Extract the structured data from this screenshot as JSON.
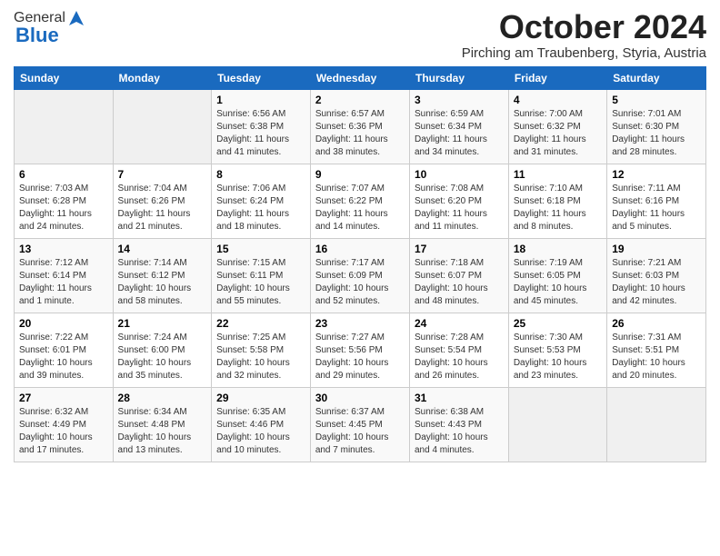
{
  "header": {
    "logo_general": "General",
    "logo_blue": "Blue",
    "month_year": "October 2024",
    "subtitle": "Pirching am Traubenberg, Styria, Austria"
  },
  "days_of_week": [
    "Sunday",
    "Monday",
    "Tuesday",
    "Wednesday",
    "Thursday",
    "Friday",
    "Saturday"
  ],
  "weeks": [
    [
      {
        "day": "",
        "info": ""
      },
      {
        "day": "",
        "info": ""
      },
      {
        "day": "1",
        "info": "Sunrise: 6:56 AM\nSunset: 6:38 PM\nDaylight: 11 hours and 41 minutes."
      },
      {
        "day": "2",
        "info": "Sunrise: 6:57 AM\nSunset: 6:36 PM\nDaylight: 11 hours and 38 minutes."
      },
      {
        "day": "3",
        "info": "Sunrise: 6:59 AM\nSunset: 6:34 PM\nDaylight: 11 hours and 34 minutes."
      },
      {
        "day": "4",
        "info": "Sunrise: 7:00 AM\nSunset: 6:32 PM\nDaylight: 11 hours and 31 minutes."
      },
      {
        "day": "5",
        "info": "Sunrise: 7:01 AM\nSunset: 6:30 PM\nDaylight: 11 hours and 28 minutes."
      }
    ],
    [
      {
        "day": "6",
        "info": "Sunrise: 7:03 AM\nSunset: 6:28 PM\nDaylight: 11 hours and 24 minutes."
      },
      {
        "day": "7",
        "info": "Sunrise: 7:04 AM\nSunset: 6:26 PM\nDaylight: 11 hours and 21 minutes."
      },
      {
        "day": "8",
        "info": "Sunrise: 7:06 AM\nSunset: 6:24 PM\nDaylight: 11 hours and 18 minutes."
      },
      {
        "day": "9",
        "info": "Sunrise: 7:07 AM\nSunset: 6:22 PM\nDaylight: 11 hours and 14 minutes."
      },
      {
        "day": "10",
        "info": "Sunrise: 7:08 AM\nSunset: 6:20 PM\nDaylight: 11 hours and 11 minutes."
      },
      {
        "day": "11",
        "info": "Sunrise: 7:10 AM\nSunset: 6:18 PM\nDaylight: 11 hours and 8 minutes."
      },
      {
        "day": "12",
        "info": "Sunrise: 7:11 AM\nSunset: 6:16 PM\nDaylight: 11 hours and 5 minutes."
      }
    ],
    [
      {
        "day": "13",
        "info": "Sunrise: 7:12 AM\nSunset: 6:14 PM\nDaylight: 11 hours and 1 minute."
      },
      {
        "day": "14",
        "info": "Sunrise: 7:14 AM\nSunset: 6:12 PM\nDaylight: 10 hours and 58 minutes."
      },
      {
        "day": "15",
        "info": "Sunrise: 7:15 AM\nSunset: 6:11 PM\nDaylight: 10 hours and 55 minutes."
      },
      {
        "day": "16",
        "info": "Sunrise: 7:17 AM\nSunset: 6:09 PM\nDaylight: 10 hours and 52 minutes."
      },
      {
        "day": "17",
        "info": "Sunrise: 7:18 AM\nSunset: 6:07 PM\nDaylight: 10 hours and 48 minutes."
      },
      {
        "day": "18",
        "info": "Sunrise: 7:19 AM\nSunset: 6:05 PM\nDaylight: 10 hours and 45 minutes."
      },
      {
        "day": "19",
        "info": "Sunrise: 7:21 AM\nSunset: 6:03 PM\nDaylight: 10 hours and 42 minutes."
      }
    ],
    [
      {
        "day": "20",
        "info": "Sunrise: 7:22 AM\nSunset: 6:01 PM\nDaylight: 10 hours and 39 minutes."
      },
      {
        "day": "21",
        "info": "Sunrise: 7:24 AM\nSunset: 6:00 PM\nDaylight: 10 hours and 35 minutes."
      },
      {
        "day": "22",
        "info": "Sunrise: 7:25 AM\nSunset: 5:58 PM\nDaylight: 10 hours and 32 minutes."
      },
      {
        "day": "23",
        "info": "Sunrise: 7:27 AM\nSunset: 5:56 PM\nDaylight: 10 hours and 29 minutes."
      },
      {
        "day": "24",
        "info": "Sunrise: 7:28 AM\nSunset: 5:54 PM\nDaylight: 10 hours and 26 minutes."
      },
      {
        "day": "25",
        "info": "Sunrise: 7:30 AM\nSunset: 5:53 PM\nDaylight: 10 hours and 23 minutes."
      },
      {
        "day": "26",
        "info": "Sunrise: 7:31 AM\nSunset: 5:51 PM\nDaylight: 10 hours and 20 minutes."
      }
    ],
    [
      {
        "day": "27",
        "info": "Sunrise: 6:32 AM\nSunset: 4:49 PM\nDaylight: 10 hours and 17 minutes."
      },
      {
        "day": "28",
        "info": "Sunrise: 6:34 AM\nSunset: 4:48 PM\nDaylight: 10 hours and 13 minutes."
      },
      {
        "day": "29",
        "info": "Sunrise: 6:35 AM\nSunset: 4:46 PM\nDaylight: 10 hours and 10 minutes."
      },
      {
        "day": "30",
        "info": "Sunrise: 6:37 AM\nSunset: 4:45 PM\nDaylight: 10 hours and 7 minutes."
      },
      {
        "day": "31",
        "info": "Sunrise: 6:38 AM\nSunset: 4:43 PM\nDaylight: 10 hours and 4 minutes."
      },
      {
        "day": "",
        "info": ""
      },
      {
        "day": "",
        "info": ""
      }
    ]
  ]
}
